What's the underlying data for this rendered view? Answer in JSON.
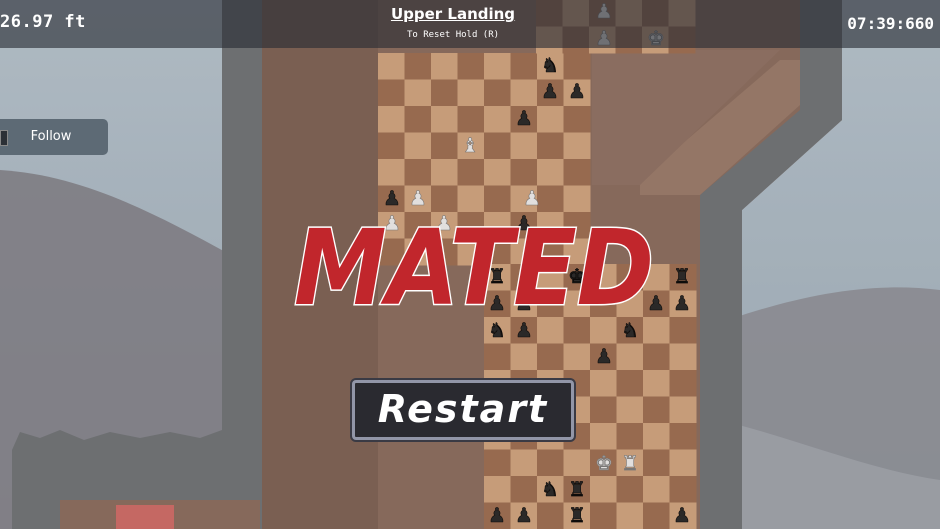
{
  "hud": {
    "height_readout": "26.97 ft",
    "area_name": "Upper Landing",
    "reset_hint": "To Reset Hold (R)",
    "timer": "07:39:660",
    "follow_label": "Follow"
  },
  "overlay": {
    "status_text": "MATED",
    "restart_label": "Restart"
  },
  "colors": {
    "sky": "#aab8c4",
    "tower_fill": "#8a6c5d",
    "tower_edge": "#6e7276",
    "light_square": "#d3a57f",
    "dark_square": "#9e6d4f",
    "mated_red": "#c1262c",
    "white_piece": "#f2f2f2",
    "black_piece": "#232323"
  }
}
